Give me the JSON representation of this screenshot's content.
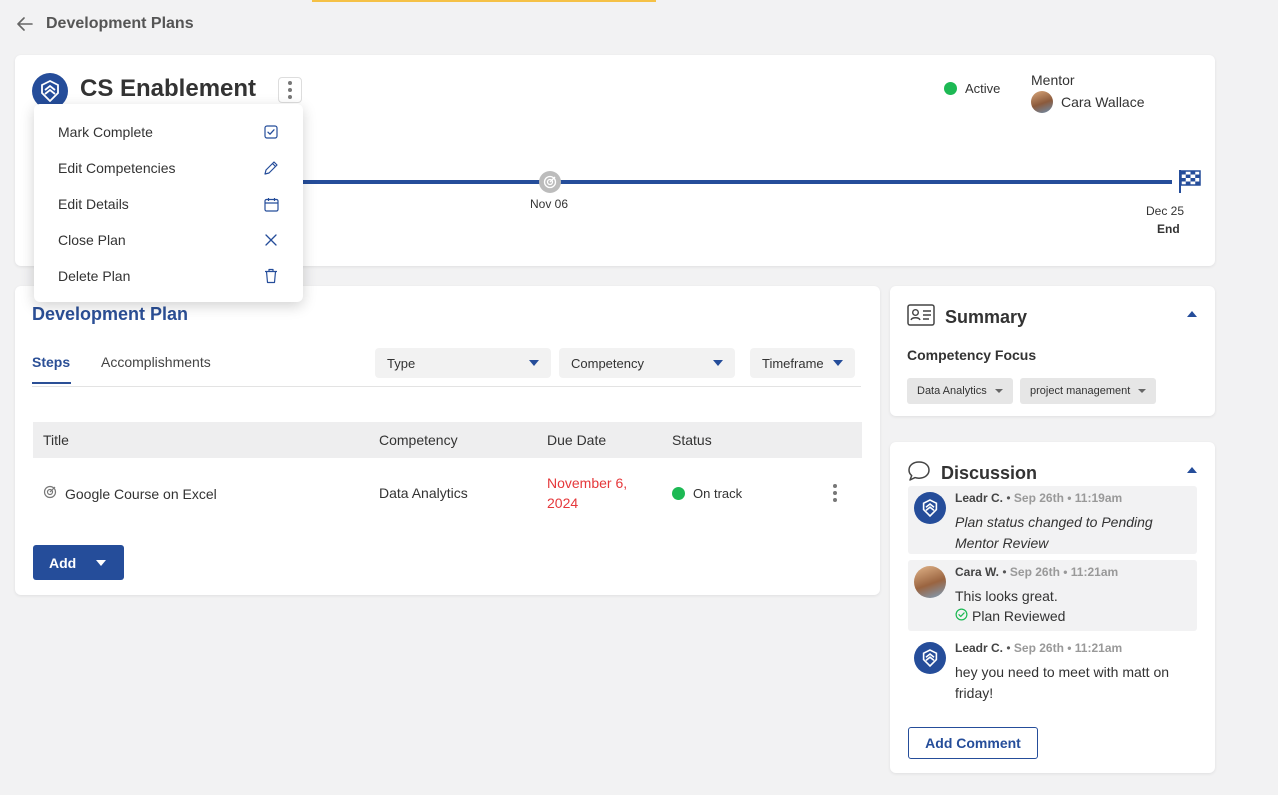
{
  "topbar": {
    "title": "Development Plans"
  },
  "plan": {
    "title": "CS Enablement",
    "status": "Active",
    "mentor_label": "Mentor",
    "mentor_name": "Cara Wallace",
    "timeline": {
      "milestone_date": "Nov 06",
      "end_date": "Dec 25",
      "end_label": "End"
    }
  },
  "menu": {
    "items": [
      {
        "label": "Mark Complete",
        "icon": "check-square-icon"
      },
      {
        "label": "Edit Competencies",
        "icon": "pencil-icon"
      },
      {
        "label": "Edit Details",
        "icon": "calendar-icon"
      },
      {
        "label": "Close Plan",
        "icon": "close-icon"
      },
      {
        "label": "Delete Plan",
        "icon": "trash-icon"
      }
    ]
  },
  "dev_plan": {
    "title": "Development Plan",
    "tabs": [
      "Steps",
      "Accomplishments"
    ],
    "active_tab": "Steps",
    "filters": [
      "Type",
      "Competency",
      "Timeframe"
    ],
    "columns": [
      "Title",
      "Competency",
      "Due Date",
      "Status"
    ],
    "rows": [
      {
        "title": "Google Course on Excel",
        "competency": "Data Analytics",
        "due_date": "November 6, 2024",
        "status": "On track"
      }
    ],
    "add_label": "Add"
  },
  "summary": {
    "title": "Summary",
    "competency_focus_label": "Competency Focus",
    "tags": [
      "Data Analytics",
      "project management"
    ]
  },
  "discussion": {
    "title": "Discussion",
    "comments": [
      {
        "author": "Leadr C.",
        "time": "Sep 26th • 11:19am",
        "text": "Plan status changed to Pending Mentor Review"
      },
      {
        "author": "Cara W.",
        "time": "Sep 26th • 11:21am",
        "text": "This looks great.",
        "sub": "Plan Reviewed"
      },
      {
        "author": "Leadr C.",
        "time": "Sep 26th • 11:21am",
        "text": "hey you need to meet with matt on friday!"
      }
    ],
    "add_comment_label": "Add Comment"
  },
  "colors": {
    "brand": "#254d9a",
    "status_green": "#1db954",
    "overdue_red": "#e5383b"
  }
}
